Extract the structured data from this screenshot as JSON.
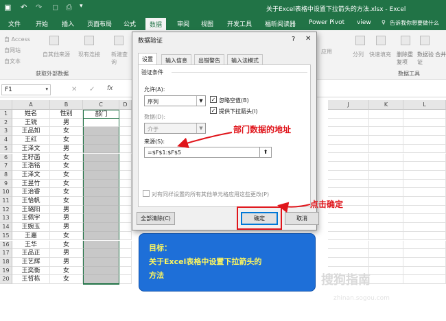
{
  "window": {
    "title": "关于Excel表格中设置下拉箭头的方法.xlsx - Excel"
  },
  "ribbon_tabs": [
    "文件",
    "开始",
    "插入",
    "页面布局",
    "公式",
    "数据",
    "审阅",
    "视图",
    "开发工具",
    "福昕阅读器",
    "Power Pivot",
    "view"
  ],
  "tell_me": "告诉我你想要做什么",
  "ribbon": {
    "access": "自 Access",
    "web": "自网站",
    "text": "自文本",
    "other_sources": "自其他来源",
    "existing": "现有连接",
    "new_query": "新建查询",
    "group_external": "获取外部数据",
    "group_tools": "数据工具",
    "items_right": [
      "分列",
      "快速填充",
      "删除重复项",
      "数据验证",
      "合并"
    ],
    "apply": "应用"
  },
  "formula_bar": {
    "name_box": "F1",
    "fx": "fx"
  },
  "sheet": {
    "columns": [
      "A",
      "B",
      "C",
      "D",
      "E",
      "F",
      "G",
      "H",
      "I",
      "J",
      "K",
      "L"
    ],
    "headers": [
      "姓名",
      "性别",
      "部门"
    ],
    "names": [
      "王锐",
      "王品如",
      "王红",
      "王泽文",
      "王籽菡",
      "王浩铭",
      "王泽文",
      "王昱竹",
      "王治睿",
      "王恰帆",
      "王璐阳",
      "王佩宇",
      "王婉玉",
      "王嘉",
      "王华",
      "王品正",
      "王艺辉",
      "王奕衡",
      "王哲栋"
    ],
    "genders": [
      "男",
      "女",
      "女",
      "男",
      "女",
      "女",
      "女",
      "女",
      "女",
      "女",
      "男",
      "男",
      "男",
      "女",
      "女",
      "男",
      "男",
      "女",
      "女"
    ]
  },
  "dialog": {
    "title": "数据验证",
    "help": "?",
    "close": "✕",
    "tabs": [
      "设置",
      "输入信息",
      "出错警告",
      "输入法模式"
    ],
    "section": "验证条件",
    "allow_label": "允许(A):",
    "allow_value": "序列",
    "ignore_blank": "忽略空值(B)",
    "dropdown": "提供下拉箭头(I)",
    "data_label": "数据(D):",
    "data_value": "介于",
    "source_label": "来源(S):",
    "source_value": "=$F$1:$F$5",
    "apply_all": "对有同样设置的所有其他单元格应用这些更改(P)",
    "clear_all": "全部清除(C)",
    "ok": "确定",
    "cancel": "取消"
  },
  "annotations": {
    "dept_address": "部门数据的地址",
    "click_ok": "点击确定"
  },
  "goal_box": {
    "line1": "目标：",
    "line2": "关于Excel表格中设置下拉箭头的",
    "line3": "方法"
  },
  "watermark": {
    "main": "搜狗指南",
    "sub": "zhinan.sogou.com"
  },
  "colors": {
    "excel_green": "#217346",
    "callout_red": "#e0151b",
    "goal_blue": "#1e6fd8",
    "goal_text": "#fff75e"
  }
}
